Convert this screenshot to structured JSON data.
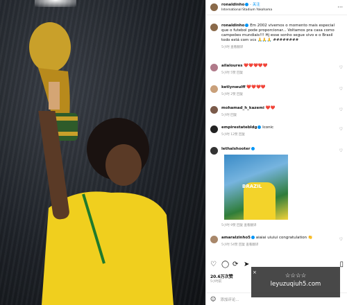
{
  "post": {
    "username": "ronaldinho",
    "follow": "关注",
    "location": "International Stadium Yokohama",
    "caption_user": "ronaldinho",
    "caption": "Em 2002 vivemos o momento mais especial que o futebol pode proporcionar... Voltamos pra casa como campeões mundiais!!! Hj esse sonho segue vivo e o Brasil todo está com vcs 🙏🙏🙏",
    "caption_extra": "########",
    "caption_meta": "5小时 查看翻译"
  },
  "comments": [
    {
      "user": "ailaloures",
      "text": "❤️❤️❤️❤️❤️",
      "meta": "5小时 5赞 回复"
    },
    {
      "user": "ketlynwulff",
      "text": "❤️❤️❤️❤️",
      "meta": "5小时 2赞 回复"
    },
    {
      "user": "mohamad_h_kazemi",
      "text": "❤️❤️",
      "meta": "5小时 回复"
    },
    {
      "user": "empirestatebldg",
      "text": "Iconic",
      "meta": "5小时 12赞 回复"
    },
    {
      "user": "lethalshooter",
      "text": "",
      "meta": "5小时 9赞 回复 查看翻译"
    },
    {
      "user": "amaralzinho5",
      "text": "aiaiai uiuiui congratulation 👏",
      "meta": "5小时 54赞 回复 查看翻译"
    }
  ],
  "comment_image_text": "BRAZIL",
  "likes": "20.6万次赞",
  "ago": "5小时前",
  "add_comment_placeholder": "添加评论...",
  "watermark_top": "☆☆☆☆",
  "watermark_bottom": "leyuzuqiuh5.com",
  "icons": {
    "like": "heart-icon",
    "comment": "comment-icon",
    "share": "share-icon",
    "repost": "repost-icon",
    "save": "bookmark-icon"
  }
}
